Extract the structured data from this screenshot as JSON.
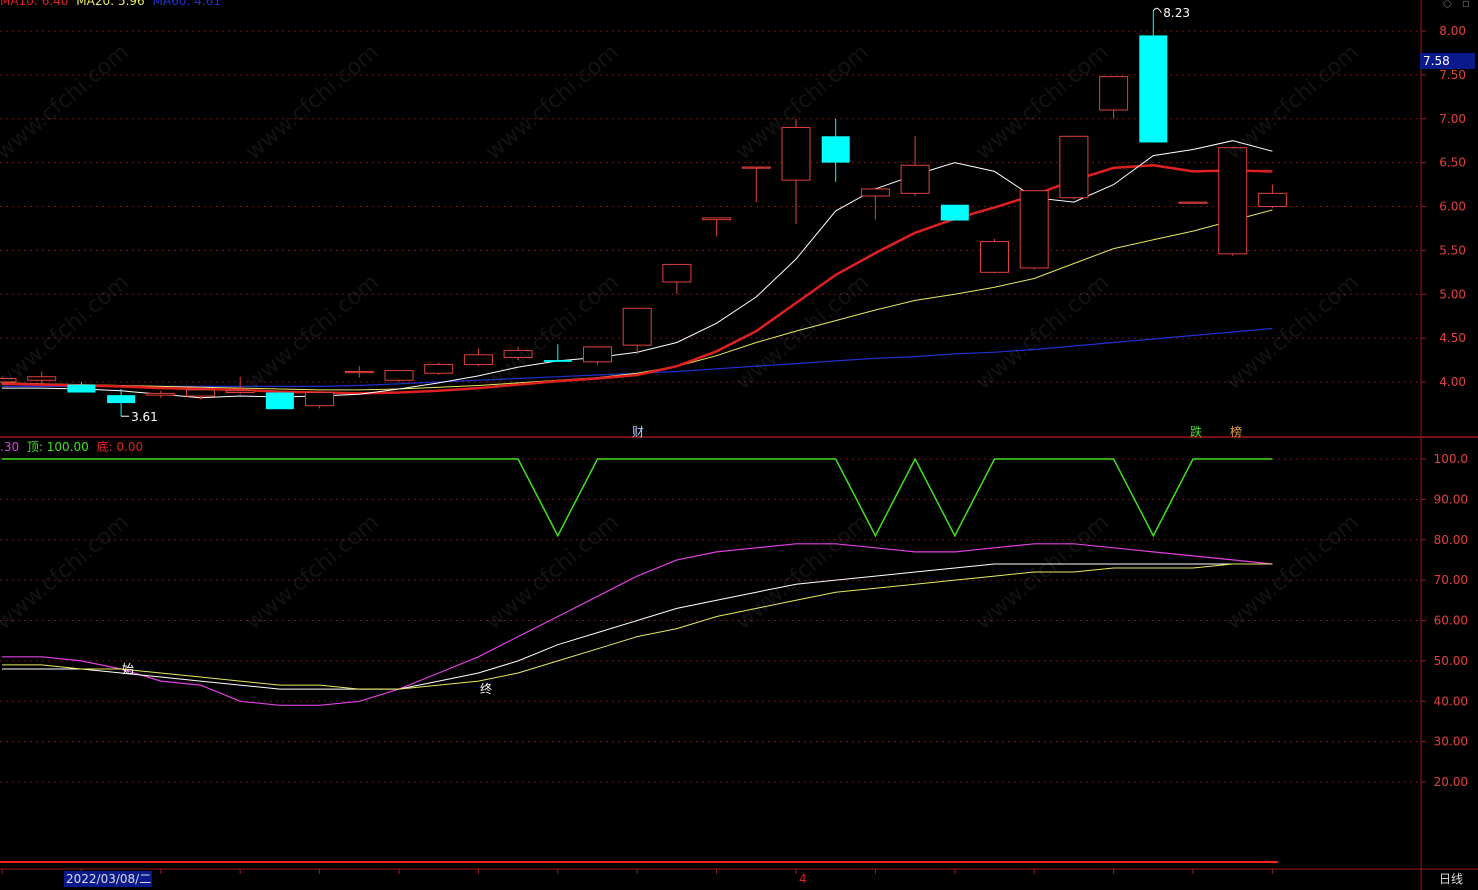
{
  "legend": {
    "ma10": "MA10: 6.40",
    "ma20": "MA20: 5.96",
    "ma60": "MA60: 4.61",
    "ind_prefix": ".30",
    "top_label": "顶: 100.00",
    "bottom_label": "底: 0.00"
  },
  "price_box": "7.58",
  "date_box": "2022/03/08/二",
  "period_button": "日线",
  "axis_marker": "4",
  "annotations": {
    "high": "8.23",
    "low": "3.61",
    "start": "始",
    "end": "终",
    "event1": "财",
    "event2": "跌",
    "event3": "榜"
  },
  "watermark": "www.cfchi.com",
  "colors": {
    "bg": "#000000",
    "up": "#e0403a",
    "down": "#00ffff",
    "ma5": "#ffffff",
    "ma10": "#e02020",
    "ma20": "#e8e860",
    "ma60": "#2030d0",
    "grid": "#7a1010",
    "zigzag": "#40e020",
    "magenta": "#e040e0"
  },
  "chart_data": [
    {
      "type": "candlestick",
      "yaxis_ticks": [
        "8.00",
        "7.50",
        "7.00",
        "6.50",
        "6.00",
        "5.50",
        "5.00",
        "4.50",
        "4.00"
      ],
      "ylim": [
        3.45,
        8.35
      ],
      "candles": [
        {
          "o": 4.0,
          "h": 4.06,
          "l": 3.98,
          "c": 4.04
        },
        {
          "o": 4.02,
          "h": 4.12,
          "l": 3.98,
          "c": 4.06
        },
        {
          "o": 3.97,
          "h": 4.0,
          "l": 3.88,
          "c": 3.88
        },
        {
          "o": 3.85,
          "h": 3.92,
          "l": 3.61,
          "c": 3.76
        },
        {
          "o": 3.85,
          "h": 3.9,
          "l": 3.82,
          "c": 3.87
        },
        {
          "o": 3.84,
          "h": 3.94,
          "l": 3.8,
          "c": 3.91
        },
        {
          "o": 3.88,
          "h": 4.06,
          "l": 3.86,
          "c": 3.9
        },
        {
          "o": 3.88,
          "h": 3.89,
          "l": 3.69,
          "c": 3.69
        },
        {
          "o": 3.73,
          "h": 3.88,
          "l": 3.7,
          "c": 3.88
        },
        {
          "o": 4.12,
          "h": 4.18,
          "l": 4.05,
          "c": 4.12
        },
        {
          "o": 4.02,
          "h": 4.13,
          "l": 4.0,
          "c": 4.13
        },
        {
          "o": 4.1,
          "h": 4.22,
          "l": 4.08,
          "c": 4.2
        },
        {
          "o": 4.2,
          "h": 4.38,
          "l": 4.18,
          "c": 4.31
        },
        {
          "o": 4.28,
          "h": 4.4,
          "l": 4.25,
          "c": 4.36
        },
        {
          "o": 4.25,
          "h": 4.43,
          "l": 4.23,
          "c": 4.23
        },
        {
          "o": 4.23,
          "h": 4.4,
          "l": 4.2,
          "c": 4.4
        },
        {
          "o": 4.42,
          "h": 4.84,
          "l": 4.32,
          "c": 4.84
        },
        {
          "o": 5.14,
          "h": 5.34,
          "l": 5.0,
          "c": 5.34
        },
        {
          "o": 5.85,
          "h": 5.87,
          "l": 5.66,
          "c": 5.87
        },
        {
          "o": 6.45,
          "h": 6.45,
          "l": 6.05,
          "c": 6.45
        },
        {
          "o": 6.3,
          "h": 7.0,
          "l": 5.8,
          "c": 6.9
        },
        {
          "o": 6.8,
          "h": 7.0,
          "l": 6.28,
          "c": 6.5
        },
        {
          "o": 6.12,
          "h": 6.22,
          "l": 5.85,
          "c": 6.2
        },
        {
          "o": 6.15,
          "h": 6.8,
          "l": 6.12,
          "c": 6.47
        },
        {
          "o": 6.02,
          "h": 6.02,
          "l": 5.84,
          "c": 5.84
        },
        {
          "o": 5.25,
          "h": 5.63,
          "l": 5.24,
          "c": 5.6
        },
        {
          "o": 5.3,
          "h": 6.18,
          "l": 5.28,
          "c": 6.18
        },
        {
          "o": 6.1,
          "h": 6.8,
          "l": 6.08,
          "c": 6.8
        },
        {
          "o": 7.1,
          "h": 7.48,
          "l": 7.0,
          "c": 7.48
        },
        {
          "o": 7.95,
          "h": 8.23,
          "l": 6.73,
          "c": 6.73
        },
        {
          "o": 6.05,
          "h": 6.05,
          "l": 6.05,
          "c": 6.05
        },
        {
          "o": 5.46,
          "h": 6.67,
          "l": 5.44,
          "c": 6.67
        },
        {
          "o": 6.0,
          "h": 6.25,
          "l": 5.98,
          "c": 6.15
        }
      ],
      "ma5": [
        3.93,
        3.93,
        3.92,
        3.9,
        3.86,
        3.82,
        3.84,
        3.83,
        3.84,
        3.86,
        3.92,
        3.99,
        4.07,
        4.17,
        4.24,
        4.28,
        4.34,
        4.45,
        4.67,
        4.97,
        5.4,
        5.95,
        6.2,
        6.36,
        6.5,
        6.4,
        6.1,
        6.05,
        6.25,
        6.58,
        6.65,
        6.75,
        6.63
      ],
      "ma10": [
        3.98,
        3.97,
        3.96,
        3.95,
        3.93,
        3.92,
        3.91,
        3.89,
        3.88,
        3.87,
        3.88,
        3.9,
        3.93,
        3.97,
        4.01,
        4.04,
        4.08,
        4.18,
        4.35,
        4.58,
        4.9,
        5.22,
        5.47,
        5.7,
        5.86,
        5.99,
        6.13,
        6.3,
        6.44,
        6.47,
        6.4,
        6.41,
        6.4
      ],
      "ma20": [
        3.99,
        3.98,
        3.97,
        3.96,
        3.95,
        3.94,
        3.93,
        3.92,
        3.91,
        3.91,
        3.92,
        3.94,
        3.96,
        3.99,
        4.02,
        4.05,
        4.1,
        4.18,
        4.3,
        4.45,
        4.58,
        4.7,
        4.82,
        4.93,
        5.0,
        5.08,
        5.18,
        5.35,
        5.52,
        5.62,
        5.72,
        5.84,
        5.96
      ],
      "ma60": [
        3.95,
        3.95,
        3.95,
        3.95,
        3.95,
        3.95,
        3.95,
        3.95,
        3.95,
        3.96,
        3.98,
        4.0,
        4.02,
        4.04,
        4.06,
        4.08,
        4.1,
        4.12,
        4.15,
        4.18,
        4.21,
        4.24,
        4.27,
        4.29,
        4.32,
        4.34,
        4.37,
        4.41,
        4.45,
        4.49,
        4.53,
        4.57,
        4.61
      ]
    },
    {
      "type": "line",
      "yaxis_ticks": [
        "100.0",
        "90.00",
        "80.00",
        "70.00",
        "60.00",
        "50.00",
        "40.00",
        "30.00",
        "20.00"
      ],
      "ylim": [
        10,
        105
      ],
      "series": [
        {
          "values": [
            100,
            100,
            100,
            100,
            100,
            100,
            100,
            100,
            100,
            100,
            100,
            100,
            100,
            100,
            81,
            100,
            100,
            100,
            100,
            100,
            100,
            100,
            81,
            100,
            81,
            100,
            100,
            100,
            100,
            81,
            100,
            100,
            100
          ]
        },
        {
          "values": [
            51,
            51,
            50,
            48,
            45,
            44,
            40,
            39,
            39,
            40,
            43,
            47,
            51,
            56,
            61,
            66,
            71,
            75,
            77,
            78,
            79,
            79,
            78,
            77,
            77,
            78,
            79,
            79,
            78,
            77,
            76,
            75,
            74
          ]
        },
        {
          "values": [
            48,
            48,
            48,
            47,
            46,
            45,
            44,
            43,
            43,
            43,
            43,
            45,
            47,
            50,
            54,
            57,
            60,
            63,
            65,
            67,
            69,
            70,
            71,
            72,
            73,
            74,
            74,
            74,
            74,
            74,
            74,
            74,
            74
          ]
        },
        {
          "values": [
            49,
            49,
            48,
            48,
            47,
            46,
            45,
            44,
            44,
            43,
            43,
            44,
            45,
            47,
            50,
            53,
            56,
            58,
            61,
            63,
            65,
            67,
            68,
            69,
            70,
            71,
            72,
            72,
            73,
            73,
            73,
            74,
            74
          ]
        }
      ]
    }
  ]
}
